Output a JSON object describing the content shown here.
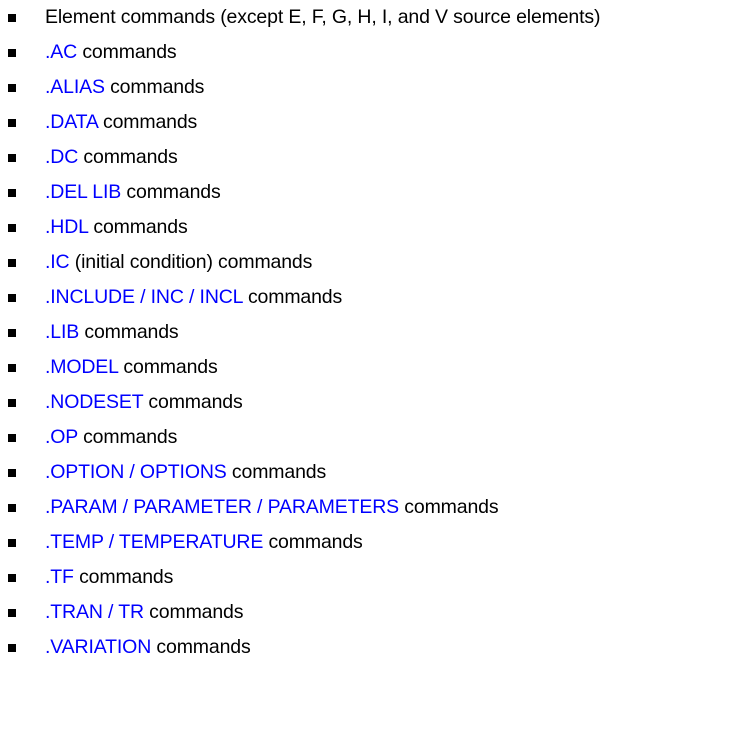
{
  "document": {
    "background_color": "#ffffff",
    "bullet_icon": "square-bullet-icon",
    "colors": {
      "command": "#0000ff",
      "text": "#000000",
      "bullet": "#000000"
    },
    "items": [
      {
        "command": "",
        "rest": "Element commands (except E, F, G, H, I, and V source elements)"
      },
      {
        "command": ".AC",
        "rest": " commands"
      },
      {
        "command": ".ALIAS",
        "rest": " commands"
      },
      {
        "command": ".DATA",
        "rest": " commands"
      },
      {
        "command": ".DC",
        "rest": " commands"
      },
      {
        "command": ".DEL LIB",
        "rest": " commands"
      },
      {
        "command": ".HDL",
        "rest": " commands"
      },
      {
        "command": ".IC",
        "rest": " (initial condition) commands"
      },
      {
        "command": ".INCLUDE / INC / INCL",
        "rest": " commands"
      },
      {
        "command": ".LIB",
        "rest": " commands"
      },
      {
        "command": ".MODEL",
        "rest": " commands"
      },
      {
        "command": ".NODESET",
        "rest": " commands"
      },
      {
        "command": ".OP",
        "rest": " commands"
      },
      {
        "command": ".OPTION / OPTIONS",
        "rest": " commands"
      },
      {
        "command": ".PARAM / PARAMETER / PARAMETERS",
        "rest": " commands"
      },
      {
        "command": ".TEMP / TEMPERATURE",
        "rest": " commands"
      },
      {
        "command": ".TF",
        "rest": " commands"
      },
      {
        "command": ".TRAN / TR",
        "rest": " commands"
      },
      {
        "command": ".VARIATION",
        "rest": " commands"
      }
    ]
  }
}
